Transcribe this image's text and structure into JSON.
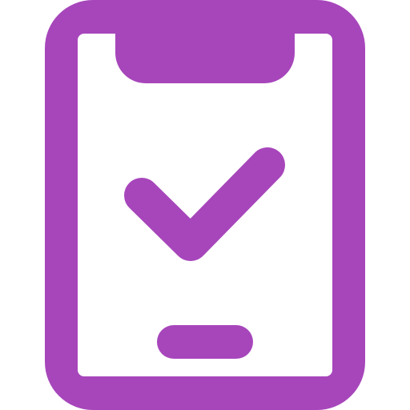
{
  "icon": {
    "name": "mobile-check-icon",
    "color": "#a746bb",
    "background": "#ffffff"
  }
}
